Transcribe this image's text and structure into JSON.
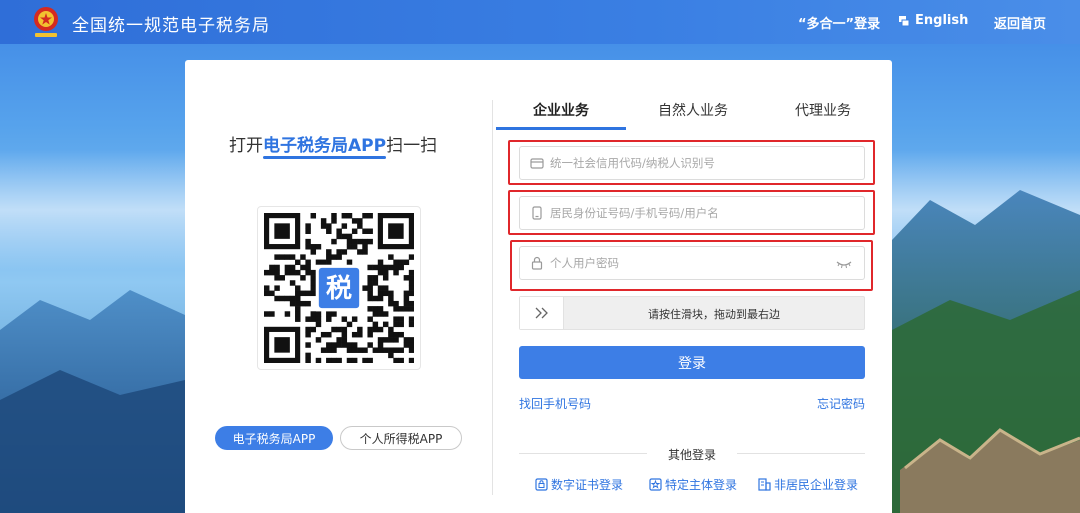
{
  "header": {
    "site_title": "全国统一规范电子税务局",
    "login_link": "“多合一”登录",
    "language_link": "English",
    "home_link": "返回首页"
  },
  "left_panel": {
    "scan_prefix": "打开",
    "scan_highlight": "电子税务局APP",
    "scan_suffix": "扫一扫",
    "qr_center_char": "税",
    "app_buttons": [
      {
        "label": "电子税务局APP",
        "active": true
      },
      {
        "label": "个人所得税APP",
        "active": false
      }
    ]
  },
  "tabs": [
    {
      "label": "企业业务",
      "active": true
    },
    {
      "label": "自然人业务",
      "active": false
    },
    {
      "label": "代理业务",
      "active": false
    }
  ],
  "form": {
    "credit_code_placeholder": "统一社会信用代码/纳税人识别号",
    "id_placeholder": "居民身份证号码/手机号码/用户名",
    "password_placeholder": "个人用户密码",
    "slider_text": "请按住滑块，拖动到最右边",
    "login_button": "登录",
    "recover_phone_link": "找回手机号码",
    "forgot_password_link": "忘记密码"
  },
  "other_login": {
    "label": "其他登录",
    "options": [
      {
        "label": "数字证书登录",
        "icon": "certificate-icon"
      },
      {
        "label": "特定主体登录",
        "icon": "star-badge-icon"
      },
      {
        "label": "非居民企业登录",
        "icon": "enterprise-icon"
      }
    ]
  },
  "colors": {
    "primary": "#3d7ee6",
    "header": "#2f6ed8",
    "highlight_outline": "#e0272b"
  }
}
